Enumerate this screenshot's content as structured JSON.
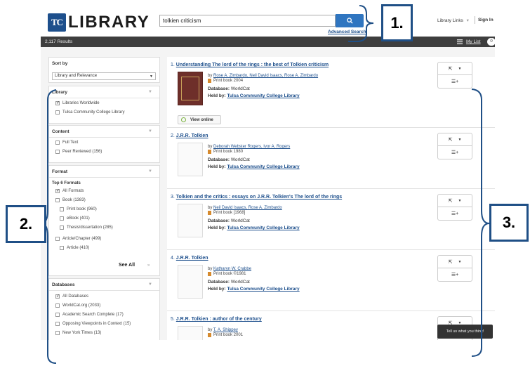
{
  "header": {
    "logo_mark": "TC",
    "logo_text": "LIBRARY",
    "search_value": "tolkien criticism",
    "advanced_search": "Advanced Search",
    "library_links": "Library Links",
    "sign_in": "Sign In"
  },
  "results_bar": {
    "count": "2,117 Results",
    "my_list": "My List",
    "my_list_count": "0"
  },
  "sidebar": {
    "sort": {
      "title": "Sort by",
      "value": "Library and Relevance"
    },
    "library": {
      "title": "Library",
      "items": [
        "Libraries Worldwide",
        "Tulsa Community College Library"
      ]
    },
    "content": {
      "title": "Content",
      "items": [
        "Full Text",
        "Peer Reviewed (156)"
      ]
    },
    "format": {
      "title": "Format",
      "subtitle": "Top 6 Formats",
      "items": [
        "All Formats",
        "Book (1383)",
        "Print book (960)",
        "eBook (401)",
        "Thesis/dissertation (285)",
        "Article/Chapter (499)",
        "Article (410)"
      ],
      "see_all": "See All"
    },
    "databases": {
      "title": "Databases",
      "items": [
        "All Databases",
        "WorldCat.org (2033)",
        "Academic Search Complete (17)",
        "Opposing Viewpoints in Context (15)",
        "New York Times (13)"
      ]
    }
  },
  "results": [
    {
      "num": "1.",
      "title": "Understanding The lord of the rings : the best of Tolkien criticism",
      "by": "by",
      "authors": "Rose A. Zimbardo, Neil David Isaacs, Rose A. Zimbardo",
      "format": "Print book 2004",
      "db_label": "Database:",
      "db": "WorldCat",
      "held_label": "Held by:",
      "held": "Tulsa Community College Library",
      "view_online": "View online"
    },
    {
      "num": "2.",
      "title": "J.R.R. Tolkien",
      "by": "by",
      "authors": "Deborah Webster Rogers, Ivor A. Rogers",
      "format": "Print book 1980",
      "db_label": "Database:",
      "db": "WorldCat",
      "held_label": "Held by:",
      "held": "Tulsa Community College Library"
    },
    {
      "num": "3.",
      "title": "Tolkien and the critics : essays on J.R.R. Tolkien's The lord of the rings",
      "by": "by",
      "authors": "Neil David Isaacs, Rose A. Zimbardo",
      "format": "Print book [1968]",
      "db_label": "Database:",
      "db": "WorldCat",
      "held_label": "Held by:",
      "held": "Tulsa Community College Library"
    },
    {
      "num": "4.",
      "title": "J.R.R. Tolkien",
      "by": "by",
      "authors": "Katharyn W. Crabbe",
      "format": "Print book ©1981",
      "db_label": "Database:",
      "db": "WorldCat",
      "held_label": "Held by:",
      "held": "Tulsa Community College Library"
    },
    {
      "num": "5.",
      "title": "J.R.R. Tolkien : author of the century",
      "by": "by",
      "authors": "T. A. Shippey",
      "format": "Print book 2001"
    }
  ],
  "feedback": "Tell us what you think!",
  "callouts": [
    "1.",
    "2.",
    "3."
  ],
  "colors": {
    "brand": "#1d4f8c",
    "search_button": "#2f75c0",
    "annotation": "#1f4f86"
  }
}
